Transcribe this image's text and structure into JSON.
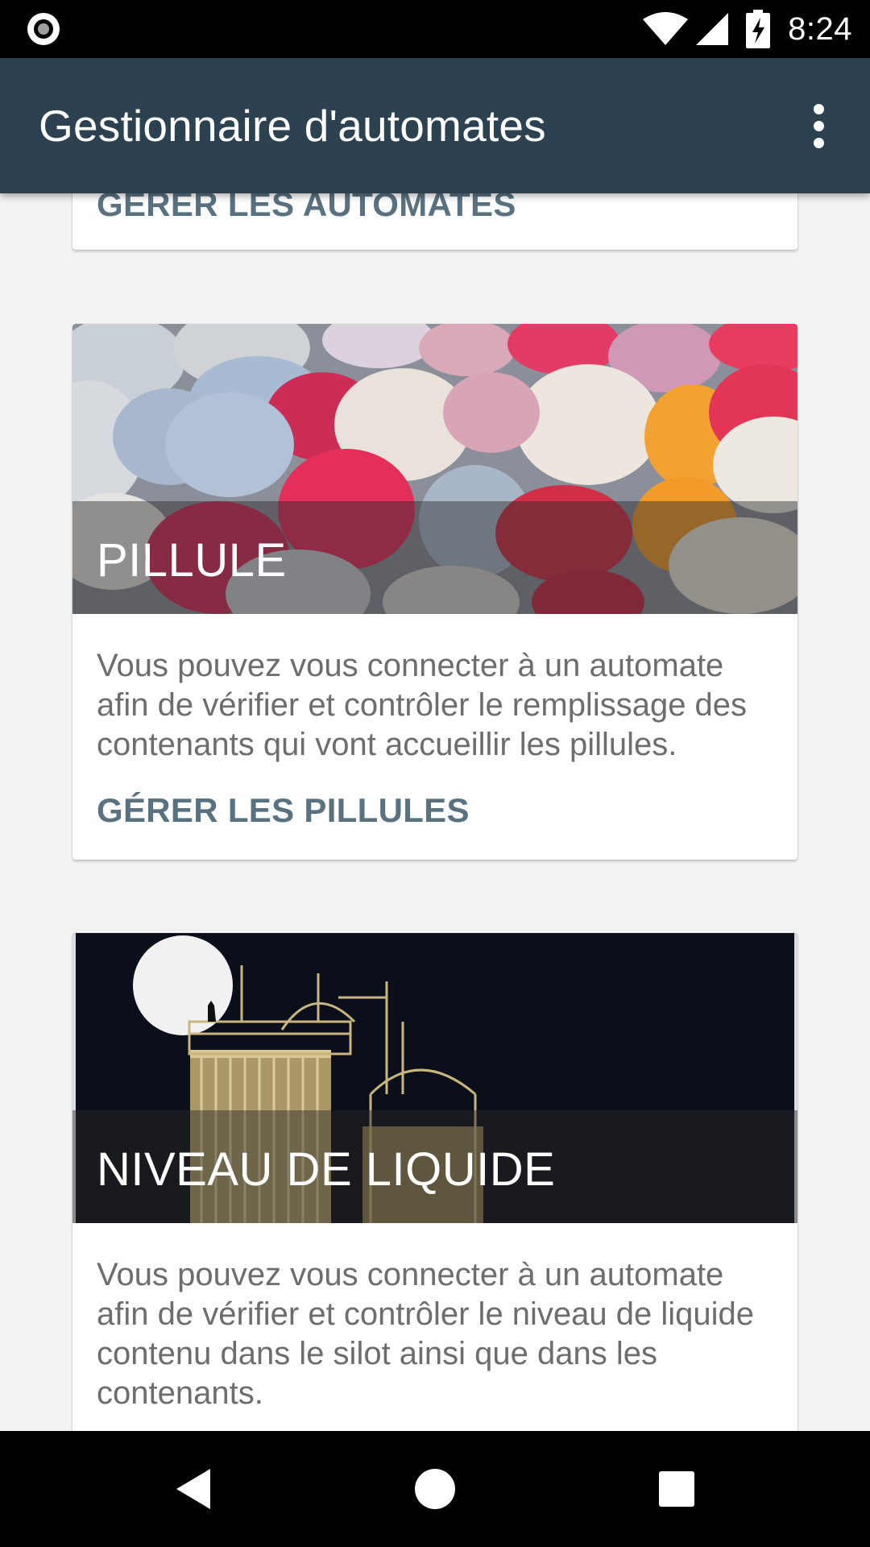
{
  "status_bar": {
    "time": "8:24",
    "icons": [
      "record-indicator-icon",
      "wifi-icon",
      "cell-signal-icon",
      "battery-charging-icon"
    ]
  },
  "app_bar": {
    "title": "Gestionnaire d'automates",
    "overflow_icon": "more-vert-icon"
  },
  "cards": [
    {
      "action_label": "GÉRER LES AUTOMATES"
    },
    {
      "title": "PILLULE",
      "description": "Vous pouvez vous connecter à un automate afin de vérifier et contrôler le remplissage des contenants qui vont accueillir les pillules.",
      "action_label": "GÉRER LES PILLULES"
    },
    {
      "title": "NIVEAU DE LIQUIDE",
      "description": "Vous pouvez vous connecter à un automate afin de vérifier et contrôler le niveau de liquide contenu dans le silot ainsi que dans les contenants."
    }
  ],
  "nav_bar": {
    "icons": [
      "back-icon",
      "home-icon",
      "recents-icon"
    ]
  },
  "colors": {
    "app_bar": "#2d4250",
    "action_text": "#5a7280",
    "body_text": "#6d6d6d",
    "background": "#f2f2f2"
  }
}
